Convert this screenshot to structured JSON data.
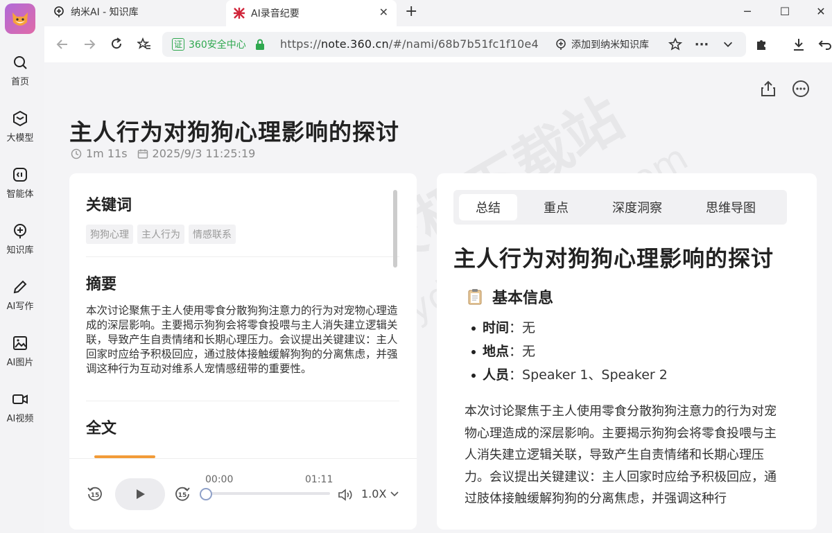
{
  "rail": {
    "items": [
      {
        "label": "首页",
        "icon": "search-icon"
      },
      {
        "label": "大模型",
        "icon": "cube-icon"
      },
      {
        "label": "智能体",
        "icon": "agent-icon"
      },
      {
        "label": "知识库",
        "icon": "knowledge-icon"
      },
      {
        "label": "AI写作",
        "icon": "pen-icon"
      },
      {
        "label": "AI图片",
        "icon": "image-icon"
      },
      {
        "label": "AI视频",
        "icon": "video-icon"
      }
    ]
  },
  "tabs": [
    {
      "title": "纳米AI - 知识库",
      "active": false
    },
    {
      "title": "AI录音纪要",
      "active": true
    }
  ],
  "address_bar": {
    "security_badge": "证",
    "security_label": "360安全中心",
    "url_prefix": "https://",
    "url_host": "note.360.cn",
    "url_path": "/#/nami/68b7b51fc1f10e4",
    "kb_add_label": "添加到纳米知识库"
  },
  "note": {
    "title": "主人行为对狗狗心理影响的探讨",
    "duration": "1m 11s",
    "datetime": "2025/9/3 11:25:19"
  },
  "left_panel": {
    "keywords_heading": "关键词",
    "keywords": [
      "狗狗心理",
      "主人行为",
      "情感联系"
    ],
    "summary_heading": "摘要",
    "summary_text": "本次讨论聚焦于主人使用零食分散狗狗注意力的行为对宠物心理造成的深层影响。主要揭示狗狗会将零食投喂与主人消失建立逻辑关联，导致产生自责情绪和长期心理压力。会议提出关键建议：主人回家时应给予积极回应，通过肢体接触缓解狗狗的分离焦虑，并强调这种行为互动对维系人宠情感纽带的重要性。",
    "fulltext_heading": "全文"
  },
  "player": {
    "current_time": "00:00",
    "total_time": "01:11",
    "speed": "1.0X",
    "progress": 0
  },
  "right_panel": {
    "tabs": [
      "总结",
      "重点",
      "深度洞察",
      "思维导图"
    ],
    "active_tab": 0,
    "title": "主人行为对狗狗心理影响的探讨",
    "subheading": "基本信息",
    "info": [
      {
        "key": "时间",
        "value": "：无"
      },
      {
        "key": "地点",
        "value": "：无"
      },
      {
        "key": "人员",
        "value": "：Speaker 1、Speaker 2"
      }
    ],
    "paragraph": "本次讨论聚焦于主人使用零食分散狗狗注意力的行为对宠物心理造成的深层影响。主要揭示狗狗会将零食投喂与主人消失建立逻辑关联，导致产生自责情绪和长期心理压力。会议提出关键建议：主人回家时应给予积极回应，通过肢体接触缓解狗狗的分离焦虑，并强调这种行"
  },
  "watermark": {
    "line1": "天极下载站",
    "line2": "mydown.yesky.com"
  },
  "colors": {
    "accent_green": "#2fa84f",
    "speaker_orange": "#f29b38",
    "play_bg": "#ececef"
  }
}
